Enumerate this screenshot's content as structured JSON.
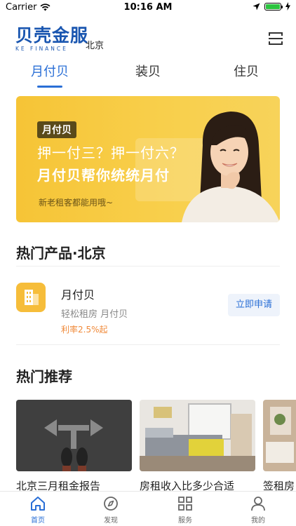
{
  "status_bar": {
    "carrier": "Carrier",
    "time": "10:16 AM"
  },
  "header": {
    "logo_cn": "贝壳金服",
    "logo_en": "KE FINANCE",
    "city": "北京",
    "menu_icon": "menu-icon"
  },
  "tabs": [
    {
      "label": "月付贝",
      "active": true
    },
    {
      "label": "装贝",
      "active": false
    },
    {
      "label": "住贝",
      "active": false
    }
  ],
  "banner": {
    "badge": "月付贝",
    "line1": "押一付三？押一付六？",
    "line2": "月付贝帮你统统月付",
    "sub": "新老租客都能用哦~"
  },
  "hot_products": {
    "title": "热门产品·北京",
    "items": [
      {
        "name": "月付贝",
        "desc": "轻松租房 月付贝",
        "rate": "利率2.5%起",
        "action": "立即申请"
      }
    ]
  },
  "recommendations": {
    "title": "热门推荐",
    "items": [
      {
        "title": "北京三月租金报告"
      },
      {
        "title": "房租收入比多少合适"
      },
      {
        "title": "签租房"
      }
    ]
  },
  "bottom_nav": [
    {
      "label": "首页",
      "icon": "home-icon",
      "active": true
    },
    {
      "label": "发现",
      "icon": "compass-icon",
      "active": false
    },
    {
      "label": "服务",
      "icon": "grid-icon",
      "active": false
    },
    {
      "label": "我的",
      "icon": "user-icon",
      "active": false
    }
  ],
  "colors": {
    "accent": "#2a6fd6",
    "banner": "#f6c436",
    "rate": "#f08a3a"
  }
}
